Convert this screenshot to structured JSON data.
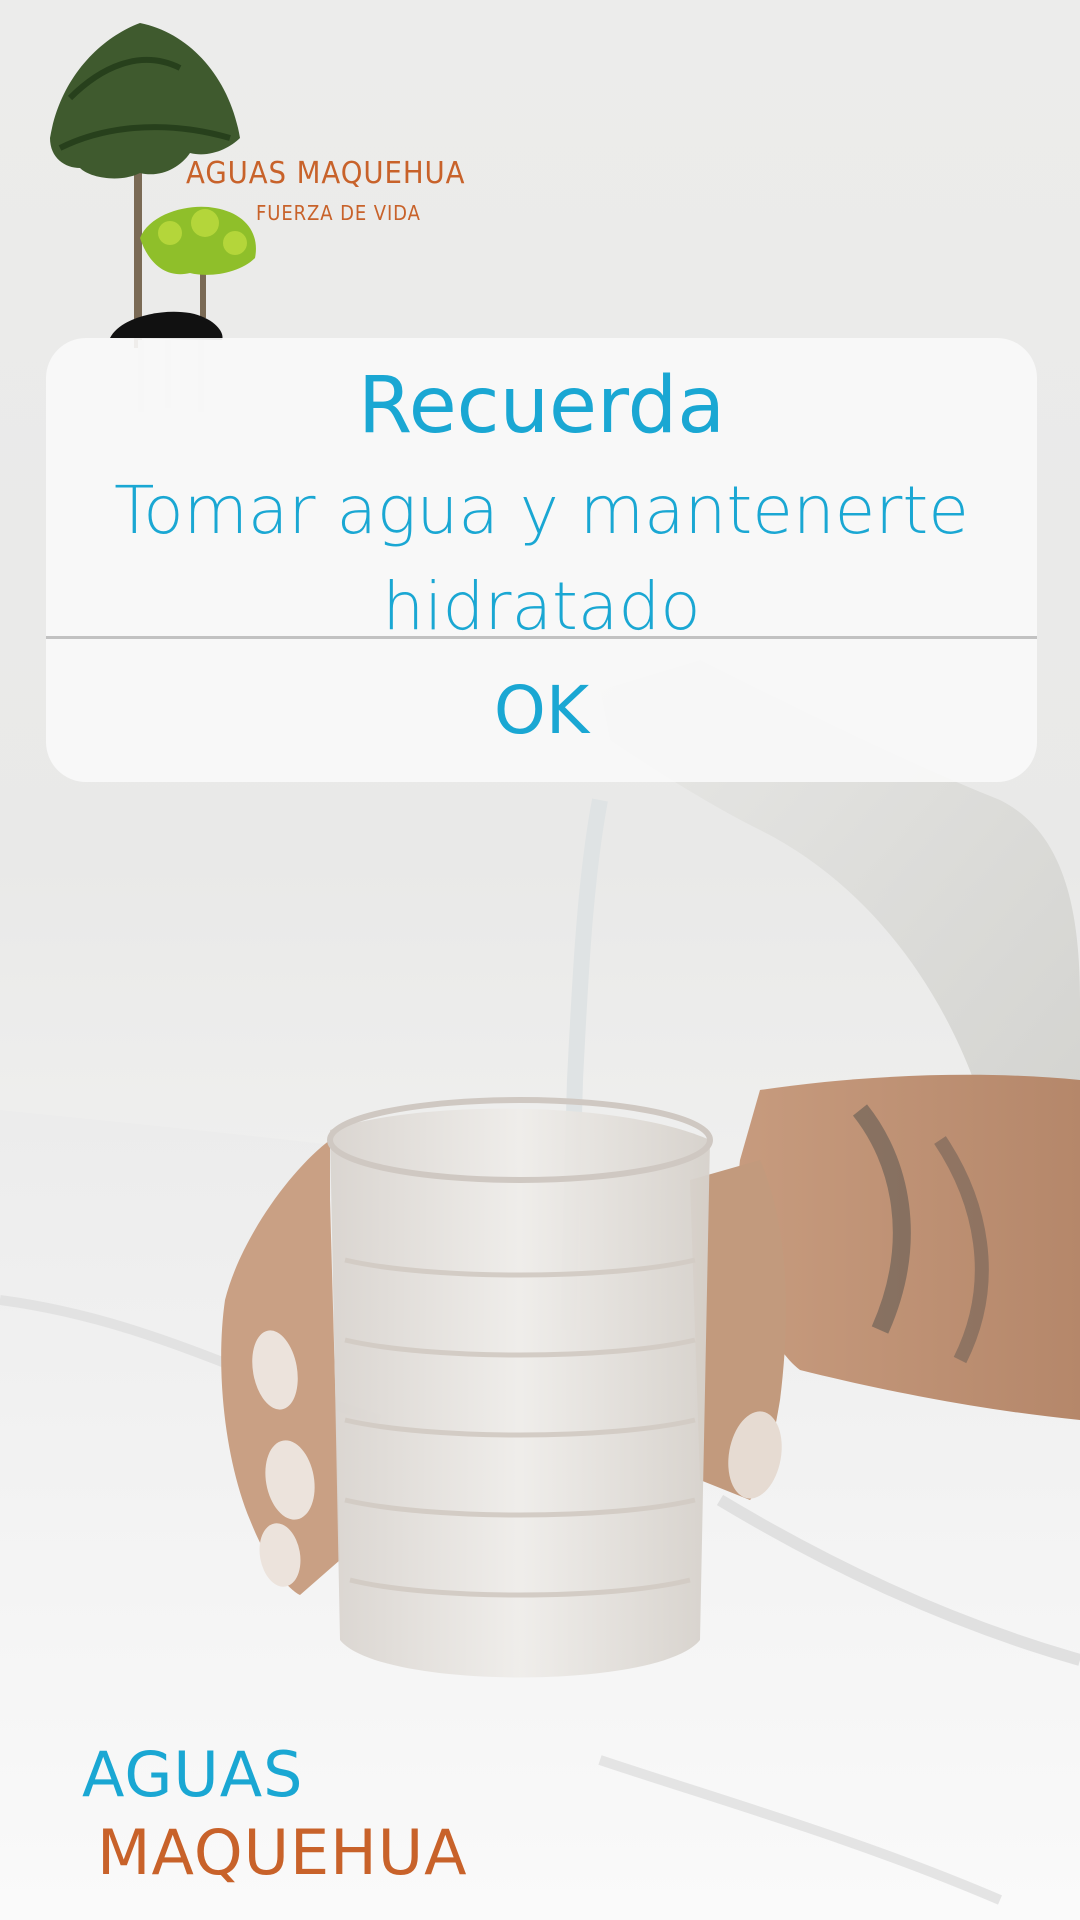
{
  "logo": {
    "title": "AGUAS MAQUEHUA",
    "tagline": "FUERZA DE VIDA"
  },
  "dialog": {
    "title": "Recuerda",
    "message": "Tomar agua y mantenerte hidratado",
    "ok_label": "OK"
  },
  "brand": {
    "line1": "AGUAS",
    "line2": "MAQUEHUA"
  },
  "colors": {
    "accent_blue": "#1aa7d3",
    "accent_orange": "#c8622a",
    "dialog_bg": "#f8f8f8"
  }
}
